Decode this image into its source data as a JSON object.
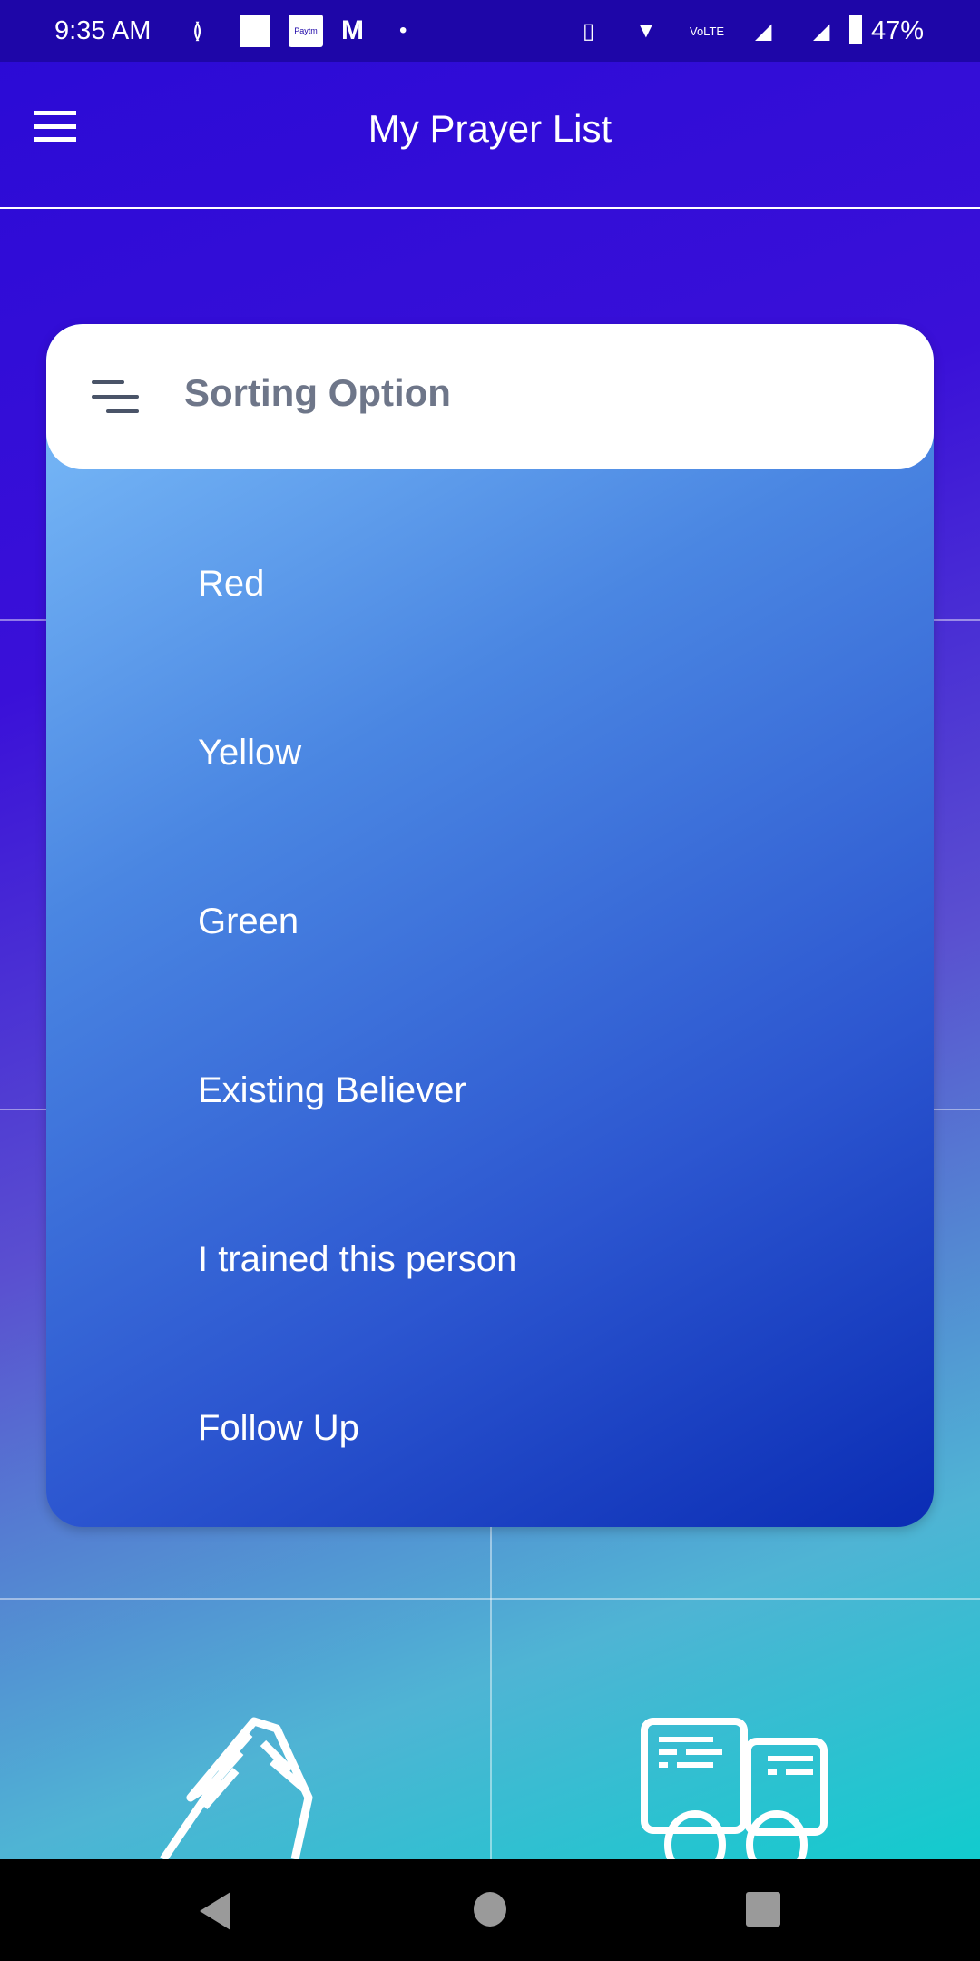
{
  "status_bar": {
    "time": "9:35 AM",
    "battery": "47%",
    "icons": [
      "sbi-icon",
      "news-icon",
      "paytm-icon",
      "myntra-icon",
      "dot-icon",
      "vibrate-icon",
      "wifi-icon",
      "volte-icon",
      "signal-icon",
      "signal-no-sim-icon",
      "battery-icon"
    ],
    "paytm_label": "Paytm"
  },
  "app_bar": {
    "title": "My Prayer List",
    "menu_icon": "hamburger-icon"
  },
  "sorting": {
    "title": "Sorting Option",
    "icon": "sort-lines-icon",
    "options": [
      "Red",
      "Yellow",
      "Green",
      "Existing Believer",
      "I trained this person",
      "Follow Up"
    ]
  },
  "tiles": [
    {
      "icon": "praying-hands-icon"
    },
    {
      "icon": "chat-people-icon"
    }
  ],
  "nav_bar": {
    "icons": [
      "back-icon",
      "home-icon",
      "recents-icon"
    ]
  }
}
